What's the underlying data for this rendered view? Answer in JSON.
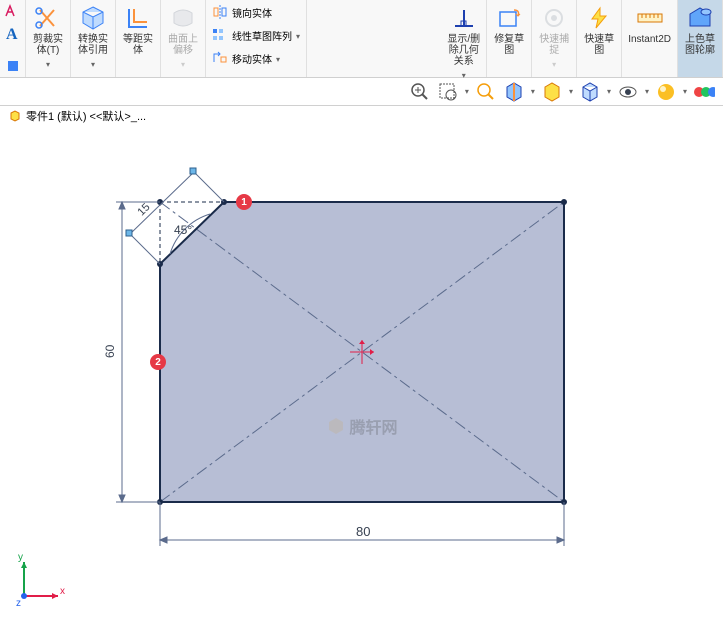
{
  "ribbon": {
    "trim": "剪裁实\n体(T)",
    "convert": "转换实\n体引用",
    "offset": "等距实\n体",
    "surface_offset": "曲面上\n偏移",
    "mirror": "镜向实体",
    "pattern": "线性草图阵列",
    "move": "移动实体",
    "display_del": "显示/删\n除几何\n关系",
    "repair": "修复草\n图",
    "quick_snap": "快速捕\n捉",
    "rapid": "快速草\n图",
    "instant": "Instant2D",
    "shade": "上色草\n图轮廓"
  },
  "breadcrumb": {
    "part": "零件1 (默认) <<默认>_..."
  },
  "annotations": {
    "badge1": "1",
    "badge2": "2"
  },
  "canvas": {
    "dim_width": "80",
    "dim_height": "60",
    "dim_chamfer": "15",
    "angle": "45°"
  },
  "watermark": "腾轩网",
  "axes": {
    "x": "x",
    "y": "y",
    "z": "z"
  },
  "chart_data": {
    "type": "cad_sketch",
    "shape": "rectangle_with_chamfer",
    "width": 80,
    "height": 60,
    "chamfer_length": 15,
    "chamfer_angle_deg": 45,
    "construction_lines": [
      "diagonal_tl_br",
      "diagonal_tr_bl"
    ],
    "annotations": [
      {
        "id": 1,
        "edge": "top"
      },
      {
        "id": 2,
        "edge": "left"
      }
    ]
  }
}
